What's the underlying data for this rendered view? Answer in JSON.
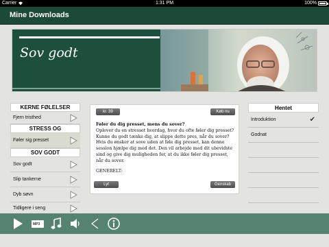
{
  "status_bar": {
    "carrier": "Carrier",
    "time": "1:31 PM",
    "battery": "100%"
  },
  "nav": {
    "title": "Mine Downloads"
  },
  "banner": {
    "title": "Sov godt"
  },
  "left_panel": {
    "sections": [
      {
        "title": "KERNE FØLELSER",
        "items": [
          {
            "label": "Fjern tristhed"
          }
        ]
      },
      {
        "title": "STRESS OG KONFLIKTER",
        "items": [
          {
            "label": "Føler sig presset"
          }
        ]
      },
      {
        "title": "SOV GODT",
        "items": [
          {
            "label": "Sov godt"
          },
          {
            "label": "Slip tankerne"
          },
          {
            "label": "Dyb søvn"
          },
          {
            "label": "Tidligere i seng"
          }
        ]
      }
    ]
  },
  "card": {
    "number": "kr. 39",
    "buy_label": "Køb nu",
    "heading": "Føler du dig presset, mens du sover?",
    "body": "Oplever du en stresset hverdag, hvor du ofte føler dig presset? Kunne du godt tænke dig, at slippe dette pres, når du sover? Hvis du ønsker at sove uden at føle dig presset, kan denne session hjælpe dig med det. Den vil arbejde med dit ubevidste sind og give dig muligheden for, at du ikke føler dig presset, når du sover.",
    "general": "GENERELT:",
    "listen_label": "Lyt",
    "restore_label": "Genskab"
  },
  "right_panel": {
    "title": "Hentet",
    "items": [
      {
        "label": "Introduktion",
        "checked": "✔"
      },
      {
        "label": "Godnat"
      }
    ]
  },
  "toolbar": {
    "mp3_label": "MP3"
  },
  "colors": {
    "nav": "#1c4938",
    "banner": "#1c4f3c",
    "toolbar": "#55836f",
    "background": "#e3e4df"
  }
}
